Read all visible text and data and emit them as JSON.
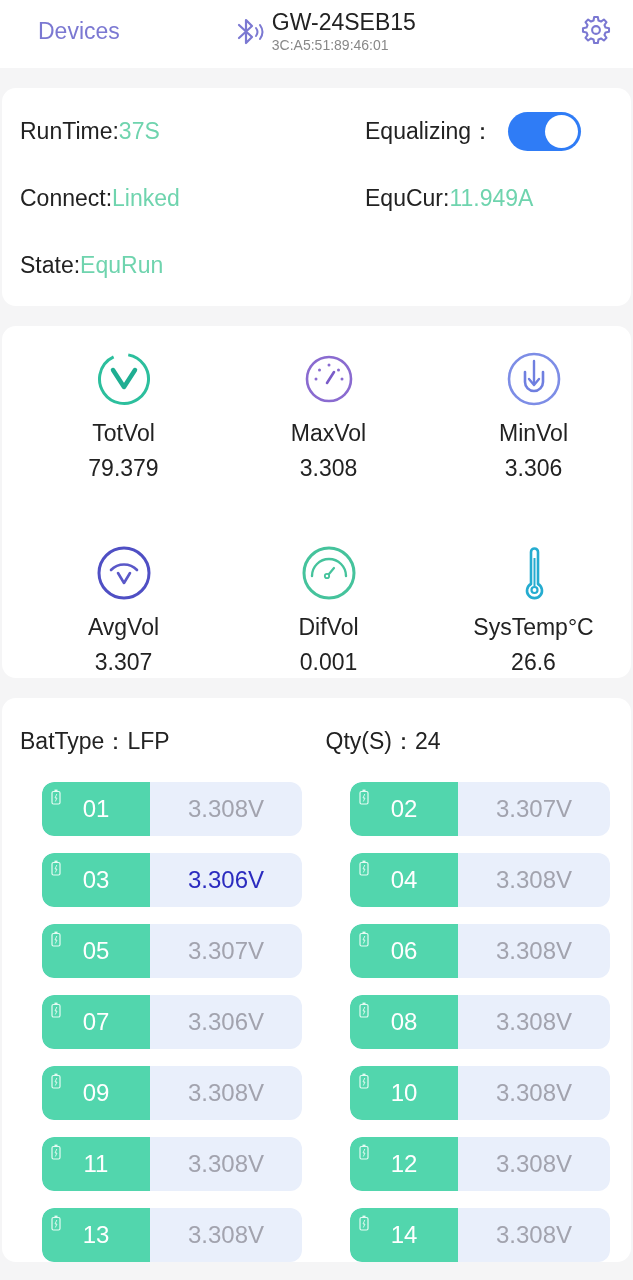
{
  "header": {
    "back_link": "Devices",
    "device_name": "GW-24SEB15",
    "mac": "3C:A5:51:89:46:01"
  },
  "status": {
    "items": [
      {
        "kind": "reading",
        "label": "RunTime:",
        "value": "37S"
      },
      {
        "kind": "toggle",
        "label": "Equalizing：",
        "on": true
      },
      {
        "kind": "reading",
        "label": "Connect:",
        "value": "Linked"
      },
      {
        "kind": "reading",
        "label": "EquCur:",
        "value": "11.949A"
      },
      {
        "kind": "reading",
        "label": "State:",
        "value": "EquRun"
      }
    ]
  },
  "stats": [
    {
      "kind": "total",
      "label": "TotVol",
      "value": "79.379"
    },
    {
      "kind": "max",
      "label": "MaxVol",
      "value": "3.308"
    },
    {
      "kind": "min",
      "label": "MinVol",
      "value": "3.306"
    },
    {
      "kind": "avg",
      "label": "AvgVol",
      "value": "3.307"
    },
    {
      "kind": "diff",
      "label": "DifVol",
      "value": "0.001"
    },
    {
      "kind": "temp",
      "label": "SysTemp°C",
      "value": "26.6"
    }
  ],
  "battery": {
    "type_label": "BatType：",
    "type_value": "LFP",
    "qty_label": "Qty(S)：",
    "qty_value": "24",
    "cells": [
      {
        "number": "01",
        "voltage": "3.308V",
        "highlighted": false
      },
      {
        "number": "02",
        "voltage": "3.307V",
        "highlighted": false
      },
      {
        "number": "03",
        "voltage": "3.306V",
        "highlighted": true
      },
      {
        "number": "04",
        "voltage": "3.308V",
        "highlighted": false
      },
      {
        "number": "05",
        "voltage": "3.307V",
        "highlighted": false
      },
      {
        "number": "06",
        "voltage": "3.308V",
        "highlighted": false
      },
      {
        "number": "07",
        "voltage": "3.306V",
        "highlighted": false
      },
      {
        "number": "08",
        "voltage": "3.308V",
        "highlighted": false
      },
      {
        "number": "09",
        "voltage": "3.308V",
        "highlighted": false
      },
      {
        "number": "10",
        "voltage": "3.308V",
        "highlighted": false
      },
      {
        "number": "11",
        "voltage": "3.308V",
        "highlighted": false
      },
      {
        "number": "12",
        "voltage": "3.308V",
        "highlighted": false
      },
      {
        "number": "13",
        "voltage": "3.308V",
        "highlighted": false
      },
      {
        "number": "14",
        "voltage": "3.308V",
        "highlighted": false
      }
    ]
  }
}
